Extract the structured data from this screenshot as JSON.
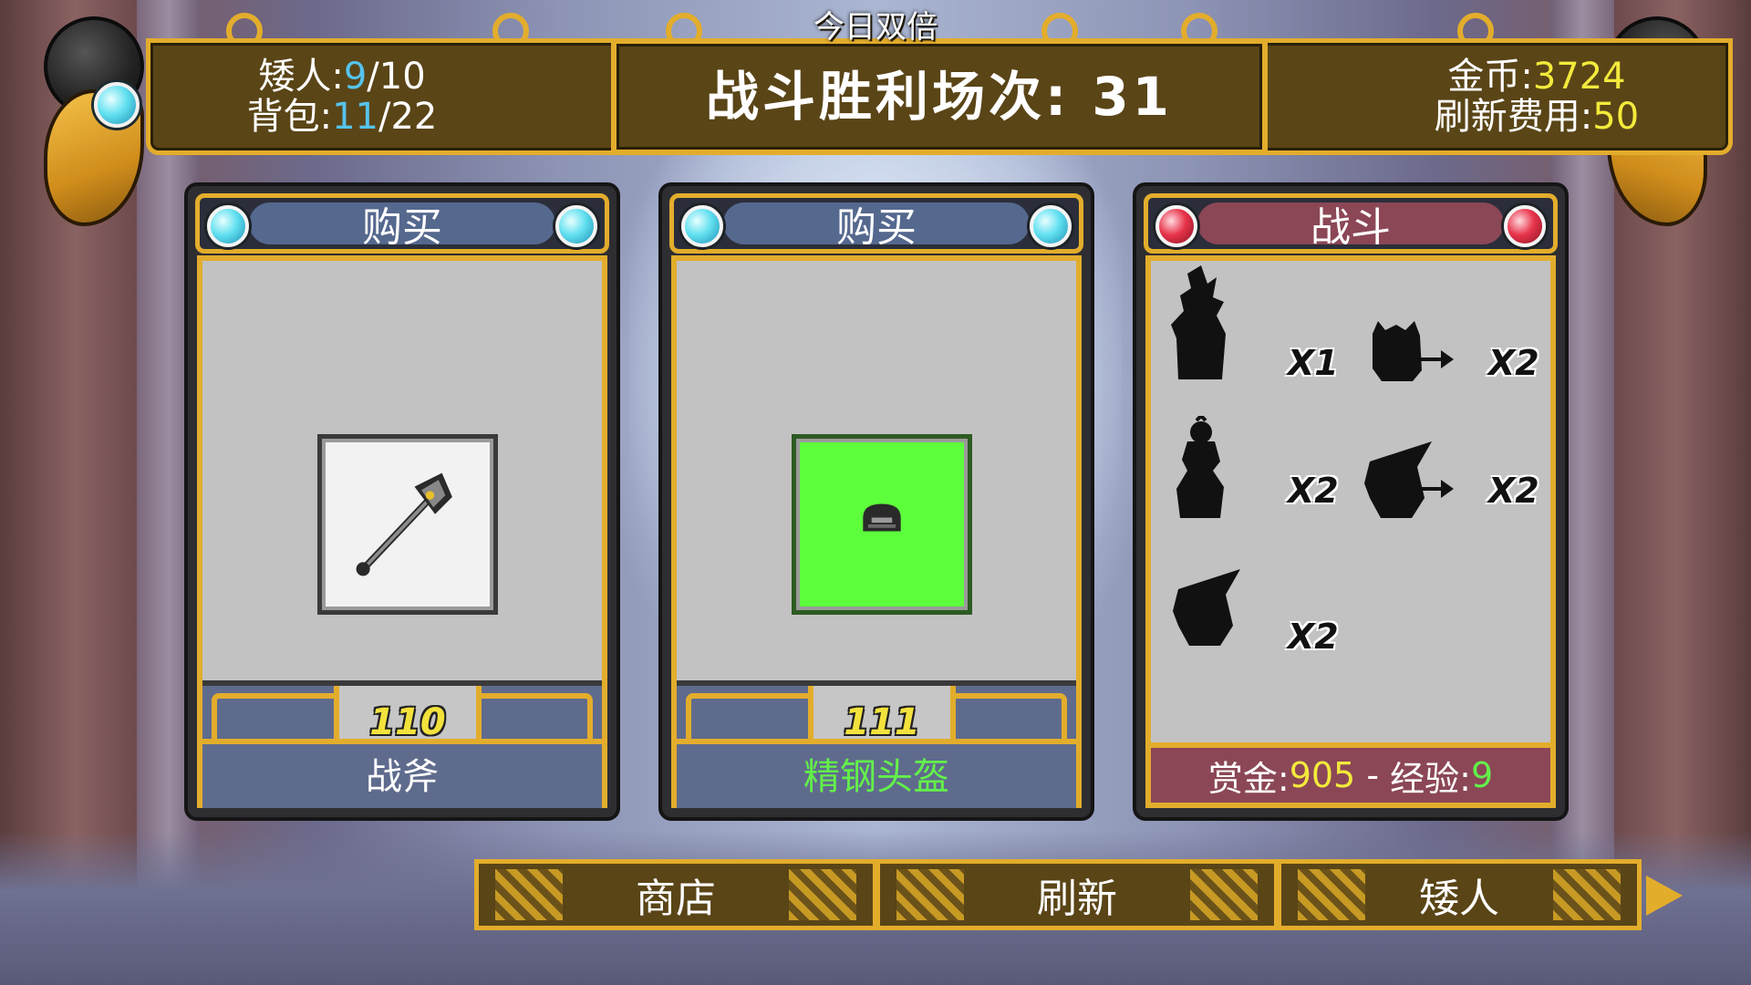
{
  "header": {
    "daily_double": "今日双倍",
    "dwarves_label": "矮人:",
    "dwarves_current": "9",
    "dwarves_max": "/10",
    "bag_label": "背包:",
    "bag_current": "11",
    "bag_max": "/22",
    "battle_wins_label": "战斗胜利场次: 31",
    "gold_label": "金币:",
    "gold_value": "3724",
    "refresh_cost_label": "刷新费用:",
    "refresh_cost_value": "50"
  },
  "cards": [
    {
      "header": "购买",
      "price": "110",
      "item_name": "战斧",
      "item_icon": "battle-axe-icon",
      "slot_color": "#f2f2f2",
      "name_color": "#ffffff"
    },
    {
      "header": "购买",
      "price": "111",
      "item_name": "精钢头盔",
      "item_icon": "steel-helmet-icon",
      "slot_color": "#5dff3c",
      "name_color": "#63f04a"
    }
  ],
  "battle": {
    "header": "战斗",
    "enemies": [
      {
        "icon": "spiky-monster-silhouette",
        "multiplier": "X1"
      },
      {
        "icon": "beast-silhouette-upgrade",
        "multiplier": "X2"
      },
      {
        "icon": "crowned-monster-silhouette",
        "multiplier": "X2"
      },
      {
        "icon": "witch-silhouette-upgrade",
        "multiplier": "X2"
      },
      {
        "icon": "witch-silhouette",
        "multiplier": "X2"
      }
    ],
    "bounty_label": "赏金:",
    "bounty_value": "905",
    "separator": "-",
    "exp_label": "经验:",
    "exp_value": "9"
  },
  "nav": {
    "shop": "商店",
    "refresh": "刷新",
    "dwarves": "矮人"
  },
  "colors": {
    "gold_frame": "#e3ad2c",
    "panel_brown": "#5a4517",
    "blue_panel": "#5f6b8d",
    "battle_red": "#8b4756",
    "highlight_blue": "#56c3ec",
    "highlight_yellow": "#f3ea3c",
    "highlight_green": "#63f04a"
  }
}
